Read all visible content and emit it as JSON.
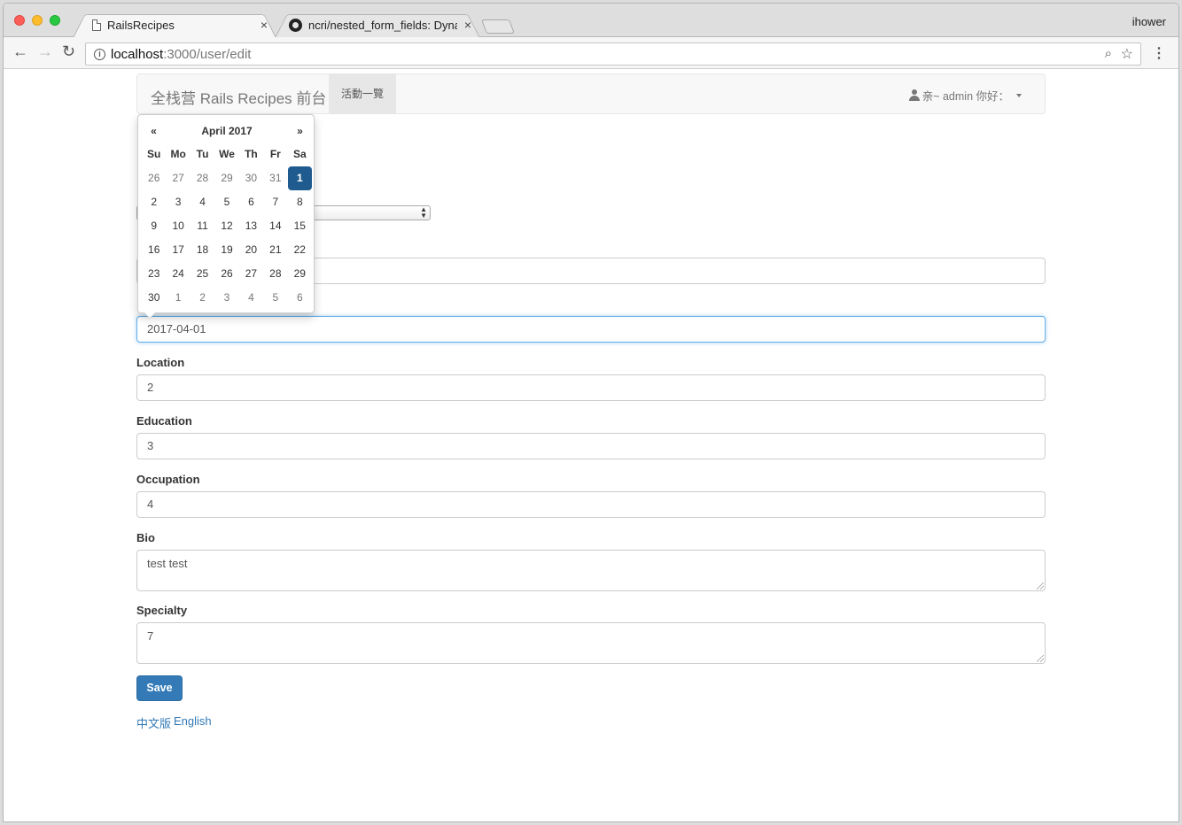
{
  "browser": {
    "tabs": [
      {
        "title": "RailsRecipes",
        "close": "×"
      },
      {
        "title": "ncri/nested_form_fields: Dynam",
        "close": "×"
      }
    ],
    "profile": "ihower",
    "url_host": "localhost",
    "url_path": ":3000/user/edit"
  },
  "navbar": {
    "brand": "全栈营 Rails Recipes 前台",
    "events": "活動一覽",
    "user": "亲~ admin 你好："
  },
  "datepicker": {
    "prev": "«",
    "next": "»",
    "title": "April 2017",
    "dow": [
      "Su",
      "Mo",
      "Tu",
      "We",
      "Th",
      "Fr",
      "Sa"
    ],
    "days": [
      {
        "d": "26",
        "t": "old"
      },
      {
        "d": "27",
        "t": "old"
      },
      {
        "d": "28",
        "t": "old"
      },
      {
        "d": "29",
        "t": "old"
      },
      {
        "d": "30",
        "t": "old"
      },
      {
        "d": "31",
        "t": "old"
      },
      {
        "d": "1",
        "t": "active"
      },
      {
        "d": "2",
        "t": ""
      },
      {
        "d": "3",
        "t": ""
      },
      {
        "d": "4",
        "t": ""
      },
      {
        "d": "5",
        "t": ""
      },
      {
        "d": "6",
        "t": ""
      },
      {
        "d": "7",
        "t": ""
      },
      {
        "d": "8",
        "t": ""
      },
      {
        "d": "9",
        "t": ""
      },
      {
        "d": "10",
        "t": ""
      },
      {
        "d": "11",
        "t": ""
      },
      {
        "d": "12",
        "t": ""
      },
      {
        "d": "13",
        "t": ""
      },
      {
        "d": "14",
        "t": ""
      },
      {
        "d": "15",
        "t": ""
      },
      {
        "d": "16",
        "t": ""
      },
      {
        "d": "17",
        "t": ""
      },
      {
        "d": "18",
        "t": ""
      },
      {
        "d": "19",
        "t": ""
      },
      {
        "d": "20",
        "t": ""
      },
      {
        "d": "21",
        "t": ""
      },
      {
        "d": "22",
        "t": ""
      },
      {
        "d": "23",
        "t": ""
      },
      {
        "d": "24",
        "t": ""
      },
      {
        "d": "25",
        "t": ""
      },
      {
        "d": "26",
        "t": ""
      },
      {
        "d": "27",
        "t": ""
      },
      {
        "d": "28",
        "t": ""
      },
      {
        "d": "29",
        "t": ""
      },
      {
        "d": "30",
        "t": ""
      },
      {
        "d": "1",
        "t": "old"
      },
      {
        "d": "2",
        "t": "old"
      },
      {
        "d": "3",
        "t": "old"
      },
      {
        "d": "4",
        "t": "old"
      },
      {
        "d": "5",
        "t": "old"
      },
      {
        "d": "6",
        "t": "old"
      }
    ]
  },
  "form": {
    "birthday_value": "2017-04-01",
    "location_label": "Location",
    "location_value": "2",
    "education_label": "Education",
    "education_value": "3",
    "occupation_label": "Occupation",
    "occupation_value": "4",
    "bio_label": "Bio",
    "bio_value": "test test",
    "specialty_label": "Specialty",
    "specialty_value": "7",
    "save_label": "Save"
  },
  "footer": {
    "lang_zh": "中文版",
    "lang_en": "English"
  },
  "colors": {
    "primary": "#337ab7",
    "active_day": "#1f5b8e"
  }
}
